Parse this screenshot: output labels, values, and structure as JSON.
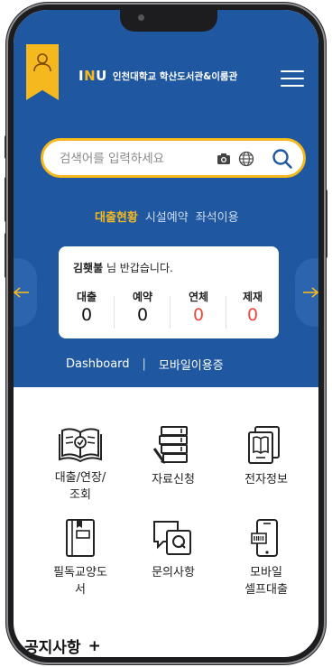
{
  "header": {
    "logo_mark_a": "I",
    "logo_mark_n": "N",
    "logo_mark_u": "U",
    "library_name": "인천대학교 학산도서관&이룸관"
  },
  "search": {
    "placeholder": "검색어를 입력하세요"
  },
  "tabs": [
    {
      "label": "대출현황",
      "active": true
    },
    {
      "label": "시설예약",
      "active": false
    },
    {
      "label": "좌석이용",
      "active": false
    }
  ],
  "card": {
    "user_name": "김횃불",
    "greeting_suffix": " 님 반갑습니다.",
    "stats": [
      {
        "label": "대출",
        "value": "0"
      },
      {
        "label": "예약",
        "value": "0"
      },
      {
        "label": "연체",
        "value": "0"
      },
      {
        "label": "제재",
        "value": "0"
      }
    ]
  },
  "links": {
    "dashboard": "Dashboard",
    "separator": "|",
    "mobile_card": "모바일이용증"
  },
  "menu_grid": [
    {
      "label": "대출/연장/\n조회",
      "icon": "open-book-icon"
    },
    {
      "label": "자료신청",
      "icon": "book-stack-icon"
    },
    {
      "label": "전자정보",
      "icon": "ebook-reader-icon"
    },
    {
      "label": "필독교양도\n서",
      "icon": "closed-book-icon"
    },
    {
      "label": "문의사항",
      "icon": "question-chat-icon"
    },
    {
      "label": "모바일\n셀프대출",
      "icon": "mobile-barcode-icon"
    }
  ],
  "notice": {
    "title": "공지사항",
    "plus": "+"
  },
  "colors": {
    "primary_blue": "#1f57a0",
    "accent_yellow": "#f5b81e",
    "alert_red": "#e84a3c"
  }
}
